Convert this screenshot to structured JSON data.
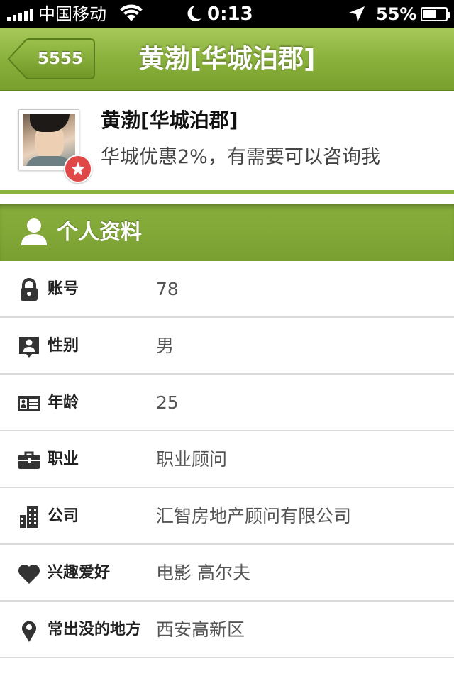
{
  "status_bar": {
    "carrier": "中国移动",
    "time": "0:13",
    "battery": "55%",
    "icons": [
      "signal-icon",
      "wifi-icon",
      "moon-icon",
      "location-arrow-icon",
      "battery-icon"
    ]
  },
  "nav": {
    "back_label": "5555",
    "title": "黄渤[华城泊郡]"
  },
  "profile": {
    "name": "黄渤[华城泊郡]",
    "description": "华城优惠2%，有需要可以咨询我",
    "badge_icon": "star-icon"
  },
  "section": {
    "title": "个人资料",
    "icon": "person-icon"
  },
  "fields": [
    {
      "label": "账号",
      "value": "78",
      "icon": "lock-icon"
    },
    {
      "label": "性别",
      "value": "男",
      "icon": "user-badge-icon"
    },
    {
      "label": "年龄",
      "value": "25",
      "icon": "id-card-icon"
    },
    {
      "label": "职业",
      "value": "职业顾问",
      "icon": "briefcase-icon"
    },
    {
      "label": "公司",
      "value": "汇智房地产顾问有限公司",
      "icon": "building-icon"
    },
    {
      "label": "兴趣爱好",
      "value": "电影 高尔夫",
      "icon": "heart-icon"
    },
    {
      "label": "常出没的地方",
      "value": "西安高新区",
      "icon": "map-pin-icon"
    }
  ],
  "colors": {
    "accent_green": "#8db33f",
    "badge_red": "#e04848"
  }
}
